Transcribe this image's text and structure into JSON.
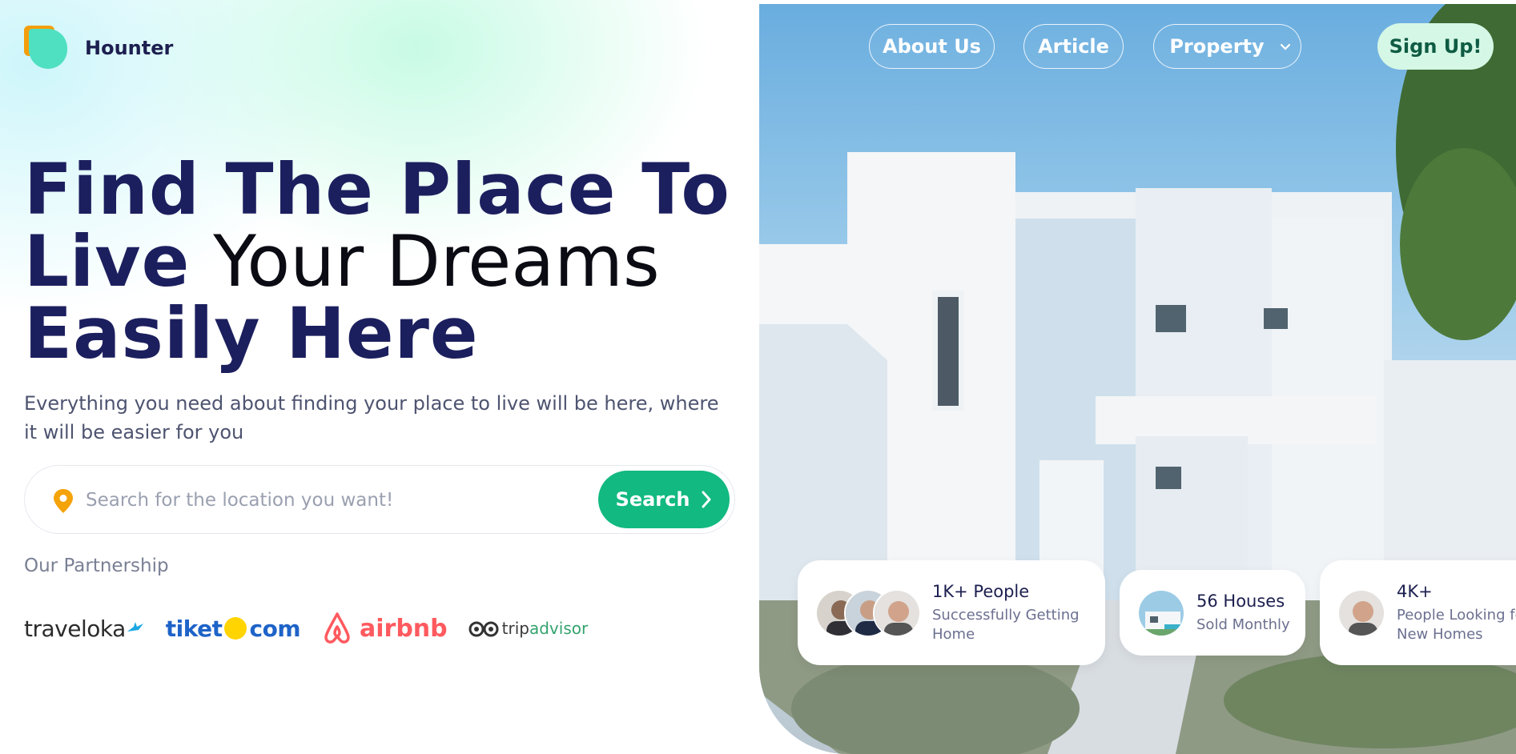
{
  "brand": {
    "name": "Hounter"
  },
  "nav": {
    "about": "About Us",
    "article": "Article",
    "property": "Property",
    "signup": "Sign Up!"
  },
  "hero": {
    "line1": "Find The Place To",
    "line2_bold": "Live",
    "line2_thin": "Your Dreams",
    "line3": "Easily Here",
    "subtitle": "Everything you need about finding your place to live will be here, where it will be easier for you"
  },
  "search": {
    "placeholder": "Search for the location you want!",
    "value": "",
    "button_label": "Search"
  },
  "partnership": {
    "label": "Our Partnership",
    "partners": [
      "traveloka",
      "tiket",
      "com",
      "airbnb",
      "trip",
      "advisor"
    ]
  },
  "stats": [
    {
      "title": "1K+ People",
      "subtitle_line1": "Successfully Getting",
      "subtitle_line2": "Home"
    },
    {
      "title": "56 Houses",
      "subtitle_line1": "Sold Monthly"
    },
    {
      "title": "4K+",
      "subtitle_line1": "People Looking fo",
      "subtitle_line2": "New Homes"
    }
  ],
  "colors": {
    "primary": "#12b981",
    "heading": "#1c1f5e",
    "signup_bg": "#d5f7e6",
    "logo_orange": "#f59e0b",
    "logo_teal": "#4fe0c1"
  },
  "icons": [
    "location-pin-icon",
    "chevron-right-icon",
    "chevron-down-icon"
  ]
}
